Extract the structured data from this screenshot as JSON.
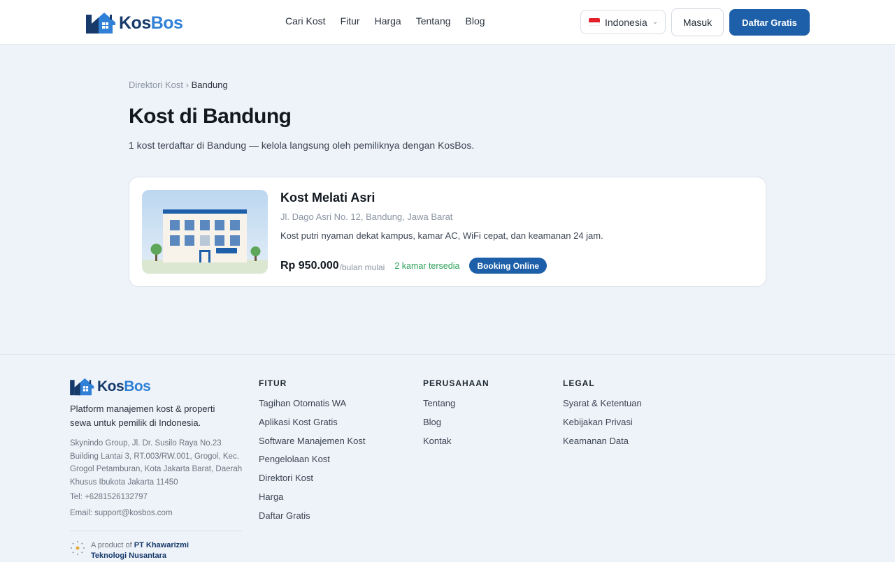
{
  "header": {
    "logo_kos": "Kos",
    "logo_bos": "Bos",
    "nav": [
      "Cari Kost",
      "Fitur",
      "Harga",
      "Tentang",
      "Blog"
    ],
    "language": "Indonesia",
    "login_label": "Masuk",
    "signup_label": "Daftar Gratis"
  },
  "main": {
    "breadcrumb_parent": "Direktori Kost",
    "breadcrumb_sep": "›",
    "breadcrumb_current": "Bandung",
    "title": "Kost di Bandung",
    "subtitle": "1 kost terdaftar di Bandung — kelola langsung oleh pemiliknya dengan KosBos.",
    "listings": [
      {
        "name": "Kost Melati Asri",
        "address": "Jl. Dago Asri No. 12, Bandung, Jawa Barat",
        "description": "Kost putri nyaman dekat kampus, kamar AC, WiFi cepat, dan keamanan 24 jam.",
        "price": "Rp 950.000",
        "price_unit": "/bulan mulai",
        "rooms": "2 kamar tersedia",
        "badge": "Booking Online"
      }
    ]
  },
  "footer": {
    "logo_kos": "Kos",
    "logo_bos": "Bos",
    "tagline": "Platform manajemen kost & properti sewa untuk pemilik di Indonesia.",
    "address": "Skynindo Group, Jl. Dr. Susilo Raya No.23 Building Lantai 3, RT.003/RW.001, Grogol, Kec. Grogol Petamburan, Kota Jakarta Barat, Daerah Khusus Ibukota Jakarta 11450",
    "tel": "Tel: +6281526132797",
    "email": "Email: support@kosbos.com",
    "product_prefix": "A product of",
    "product_company": "PT Khawarizmi Teknologi Nusantara",
    "columns": [
      {
        "title": "FITUR",
        "links": [
          "Tagihan Otomatis WA",
          "Aplikasi Kost Gratis",
          "Software Manajemen Kost",
          "Pengelolaan Kost",
          "Direktori Kost",
          "Harga",
          "Daftar Gratis"
        ]
      },
      {
        "title": "PERUSAHAAN",
        "links": [
          "Tentang",
          "Blog",
          "Kontak"
        ]
      },
      {
        "title": "LEGAL",
        "links": [
          "Syarat & Ketentuan",
          "Kebijakan Privasi",
          "Keamanan Data"
        ]
      }
    ]
  },
  "colors": {
    "primary": "#1d5fa8",
    "logo_dark": "#173a6b",
    "logo_light": "#2f80d6",
    "available_green": "#2da25a"
  },
  "icons": [
    "house-logo-icon",
    "indonesia-flag-icon",
    "chevron-down-icon",
    "sun-dots-icon"
  ]
}
